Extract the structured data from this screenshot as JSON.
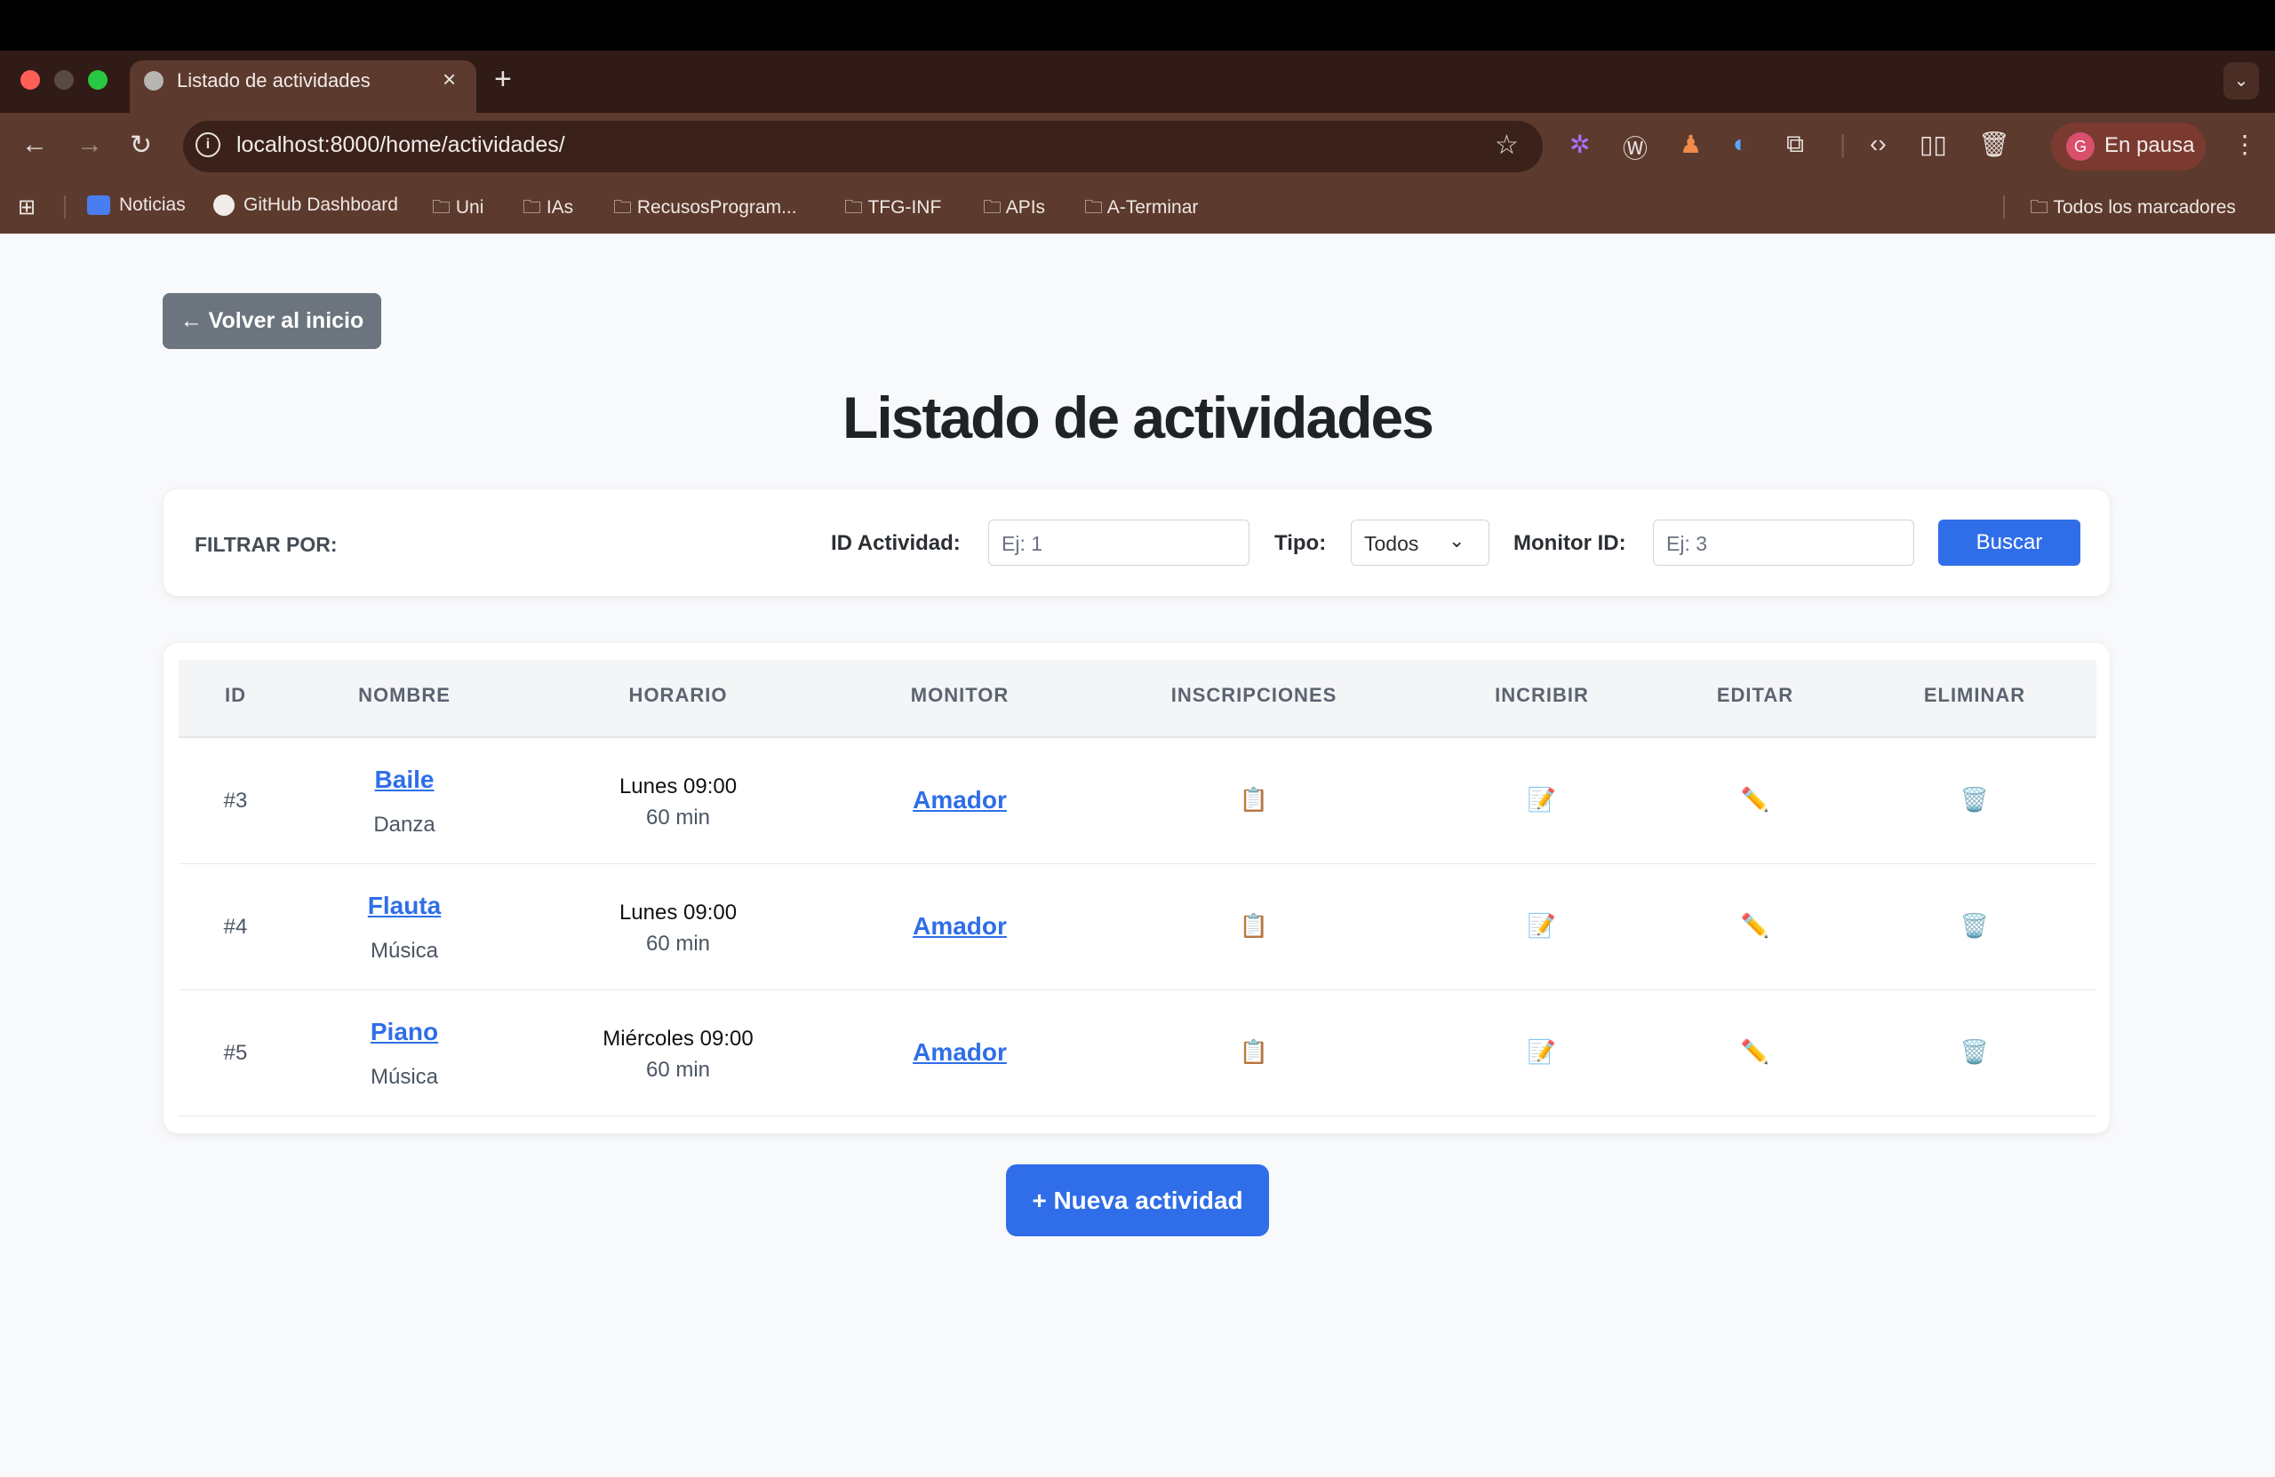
{
  "browser": {
    "tab_title": "Listado de actividades",
    "tab_close": "×",
    "new_tab": "+",
    "tab_menu": "⌄",
    "url": "localhost:8000/home/actividades/",
    "profile_initial": "G",
    "profile_status": "En pausa",
    "bookmarks": [
      "Noticias",
      "GitHub Dashboard",
      "Uni",
      "IAs",
      "RecusosProgram...",
      "TFG-INF",
      "APIs",
      "A-Terminar"
    ],
    "all_bookmarks": "Todos los marcadores"
  },
  "page": {
    "back_label": "← Volver al inicio",
    "title": "Listado de actividades",
    "new_label": "+ Nueva actividad"
  },
  "filter": {
    "heading": "FILTRAR POR:",
    "id_label": "ID Actividad:",
    "id_placeholder": "Ej: 1",
    "type_label": "Tipo:",
    "type_value": "Todos",
    "monitor_label": "Monitor ID:",
    "monitor_placeholder": "Ej: 3",
    "search_label": "Buscar"
  },
  "table": {
    "headers": [
      "ID",
      "NOMBRE",
      "HORARIO",
      "MONITOR",
      "INSCRIPCIONES",
      "INCRIBIR",
      "EDITAR",
      "ELIMINAR"
    ],
    "rows": [
      {
        "id": "#3",
        "name": "Baile",
        "type": "Danza",
        "schedule": "Lunes 09:00",
        "duration": "60 min",
        "monitor": "Amador",
        "inscripciones": "📋",
        "inscribir": "📝",
        "editar": "✏️",
        "eliminar": "🗑️"
      },
      {
        "id": "#4",
        "name": "Flauta",
        "type": "Música",
        "schedule": "Lunes 09:00",
        "duration": "60 min",
        "monitor": "Amador",
        "inscripciones": "📋",
        "inscribir": "📝",
        "editar": "✏️",
        "eliminar": "🗑️"
      },
      {
        "id": "#5",
        "name": "Piano",
        "type": "Música",
        "schedule": "Miércoles 09:00",
        "duration": "60 min",
        "monitor": "Amador",
        "inscripciones": "📋",
        "inscribir": "📝",
        "editar": "✏️",
        "eliminar": "🗑️"
      }
    ]
  }
}
